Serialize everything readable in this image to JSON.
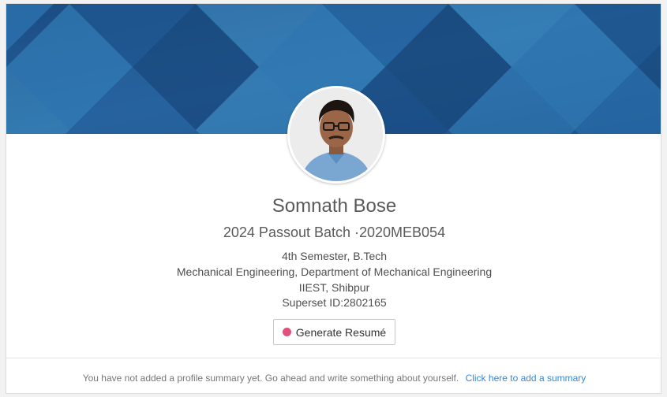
{
  "profile": {
    "name": "Somnath Bose",
    "batch": "2024 Passout Batch ·2020MEB054",
    "semester": "4th Semester, B.Tech",
    "department": "Mechanical Engineering, Department of Mechanical Engineering",
    "institute": "IIEST, Shibpur",
    "superset_id": "Superset ID:2802165"
  },
  "actions": {
    "generate_resume": "Generate Resumé"
  },
  "summary": {
    "empty_text": "You have not added a profile summary yet. Go ahead and write something about yourself.",
    "link_text": "Click here to add a summary"
  },
  "colors": {
    "banner_dark": "#1f5a93",
    "banner_light": "#4aa3d8",
    "link": "#3b87d0",
    "resume_dot": "#e0507a"
  },
  "icons": {
    "avatar": "profile-photo",
    "resume_dot": "record-dot-icon"
  }
}
